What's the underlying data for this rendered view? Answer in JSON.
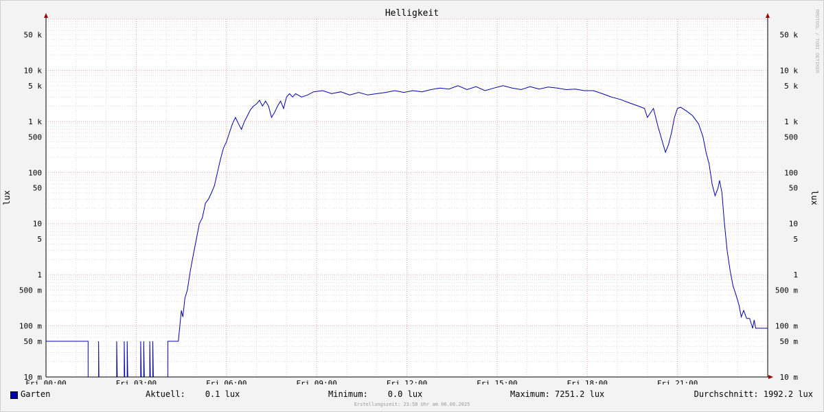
{
  "chart_data": {
    "type": "line",
    "title": "Helligkeit",
    "ylabel": "lux",
    "ylabel_right": "lux",
    "watermark": "RRDTOOL / TOBI OETIKER",
    "y_scale": "log",
    "ylim": [
      0.01,
      100000
    ],
    "y_ticks": [
      {
        "value": 0.01,
        "label": "10 m"
      },
      {
        "value": 0.05,
        "label": "50 m"
      },
      {
        "value": 0.1,
        "label": "100 m"
      },
      {
        "value": 0.5,
        "label": "500 m"
      },
      {
        "value": 1,
        "label": "1"
      },
      {
        "value": 5,
        "label": "5"
      },
      {
        "value": 10,
        "label": "10"
      },
      {
        "value": 50,
        "label": "50"
      },
      {
        "value": 100,
        "label": "100"
      },
      {
        "value": 500,
        "label": "500"
      },
      {
        "value": 1000,
        "label": "1 k"
      },
      {
        "value": 5000,
        "label": "5 k"
      },
      {
        "value": 10000,
        "label": "10 k"
      },
      {
        "value": 50000,
        "label": "50 k"
      }
    ],
    "x_range_hours": [
      0,
      24
    ],
    "x_ticks": [
      {
        "hour": 0,
        "label": "Fri 00:00"
      },
      {
        "hour": 3,
        "label": "Fri 03:00"
      },
      {
        "hour": 6,
        "label": "Fri 06:00"
      },
      {
        "hour": 9,
        "label": "Fri 09:00"
      },
      {
        "hour": 12,
        "label": "Fri 12:00"
      },
      {
        "hour": 15,
        "label": "Fri 15:00"
      },
      {
        "hour": 18,
        "label": "Fri 18:00"
      },
      {
        "hour": 21,
        "label": "Fri 21:00"
      }
    ],
    "grid": true,
    "series": [
      {
        "name": "Garten",
        "color": "#0000aa",
        "points": [
          [
            0.0,
            0.05
          ],
          [
            1.4,
            0.05
          ],
          [
            1.4,
            0.01
          ],
          [
            1.75,
            0.01
          ],
          [
            1.75,
            0.05
          ],
          [
            1.76,
            0.01
          ],
          [
            2.35,
            0.01
          ],
          [
            2.35,
            0.05
          ],
          [
            2.37,
            0.01
          ],
          [
            2.6,
            0.01
          ],
          [
            2.6,
            0.05
          ],
          [
            2.62,
            0.01
          ],
          [
            2.7,
            0.01
          ],
          [
            2.7,
            0.05
          ],
          [
            2.72,
            0.01
          ],
          [
            3.15,
            0.01
          ],
          [
            3.15,
            0.05
          ],
          [
            3.17,
            0.01
          ],
          [
            3.25,
            0.01
          ],
          [
            3.25,
            0.05
          ],
          [
            3.27,
            0.01
          ],
          [
            3.45,
            0.01
          ],
          [
            3.45,
            0.05
          ],
          [
            3.47,
            0.01
          ],
          [
            3.55,
            0.01
          ],
          [
            3.55,
            0.05
          ],
          [
            3.57,
            0.01
          ],
          [
            4.05,
            0.01
          ],
          [
            4.05,
            0.05
          ],
          [
            4.4,
            0.05
          ],
          [
            4.45,
            0.1
          ],
          [
            4.5,
            0.2
          ],
          [
            4.55,
            0.15
          ],
          [
            4.62,
            0.35
          ],
          [
            4.7,
            0.5
          ],
          [
            4.8,
            1.2
          ],
          [
            4.9,
            2.5
          ],
          [
            5.0,
            5
          ],
          [
            5.1,
            10
          ],
          [
            5.2,
            13
          ],
          [
            5.3,
            25
          ],
          [
            5.4,
            30
          ],
          [
            5.5,
            40
          ],
          [
            5.6,
            55
          ],
          [
            5.7,
            100
          ],
          [
            5.8,
            180
          ],
          [
            5.9,
            300
          ],
          [
            6.0,
            400
          ],
          [
            6.1,
            600
          ],
          [
            6.2,
            900
          ],
          [
            6.3,
            1200
          ],
          [
            6.4,
            900
          ],
          [
            6.5,
            700
          ],
          [
            6.6,
            1000
          ],
          [
            6.7,
            1300
          ],
          [
            6.8,
            1700
          ],
          [
            6.9,
            2000
          ],
          [
            7.0,
            2200
          ],
          [
            7.1,
            2600
          ],
          [
            7.2,
            2000
          ],
          [
            7.3,
            2500
          ],
          [
            7.4,
            2000
          ],
          [
            7.5,
            1200
          ],
          [
            7.6,
            1500
          ],
          [
            7.7,
            2000
          ],
          [
            7.8,
            2500
          ],
          [
            7.9,
            1800
          ],
          [
            8.0,
            3000
          ],
          [
            8.1,
            3500
          ],
          [
            8.2,
            3000
          ],
          [
            8.3,
            3500
          ],
          [
            8.5,
            3000
          ],
          [
            8.7,
            3300
          ],
          [
            8.9,
            3800
          ],
          [
            9.2,
            4000
          ],
          [
            9.5,
            3500
          ],
          [
            9.8,
            3800
          ],
          [
            10.1,
            3300
          ],
          [
            10.4,
            3700
          ],
          [
            10.7,
            3300
          ],
          [
            11.0,
            3500
          ],
          [
            11.3,
            3700
          ],
          [
            11.6,
            4000
          ],
          [
            11.9,
            3700
          ],
          [
            12.2,
            4000
          ],
          [
            12.5,
            3800
          ],
          [
            12.8,
            4200
          ],
          [
            13.1,
            4500
          ],
          [
            13.4,
            4300
          ],
          [
            13.7,
            5000
          ],
          [
            14.0,
            4200
          ],
          [
            14.3,
            4800
          ],
          [
            14.6,
            4000
          ],
          [
            14.9,
            4500
          ],
          [
            15.2,
            5000
          ],
          [
            15.5,
            4500
          ],
          [
            15.8,
            4200
          ],
          [
            16.1,
            4800
          ],
          [
            16.4,
            4300
          ],
          [
            16.7,
            4700
          ],
          [
            17.0,
            4500
          ],
          [
            17.3,
            4200
          ],
          [
            17.6,
            4300
          ],
          [
            17.9,
            4000
          ],
          [
            18.2,
            4000
          ],
          [
            18.5,
            3500
          ],
          [
            18.8,
            3000
          ],
          [
            19.1,
            2700
          ],
          [
            19.4,
            2300
          ],
          [
            19.7,
            2000
          ],
          [
            19.9,
            1800
          ],
          [
            20.0,
            1200
          ],
          [
            20.2,
            1800
          ],
          [
            20.35,
            800
          ],
          [
            20.5,
            400
          ],
          [
            20.6,
            250
          ],
          [
            20.7,
            350
          ],
          [
            20.8,
            600
          ],
          [
            20.9,
            1200
          ],
          [
            21.0,
            1800
          ],
          [
            21.1,
            1900
          ],
          [
            21.3,
            1600
          ],
          [
            21.5,
            1300
          ],
          [
            21.7,
            900
          ],
          [
            21.85,
            500
          ],
          [
            21.95,
            250
          ],
          [
            22.05,
            150
          ],
          [
            22.15,
            60
          ],
          [
            22.25,
            35
          ],
          [
            22.35,
            50
          ],
          [
            22.4,
            70
          ],
          [
            22.48,
            40
          ],
          [
            22.55,
            12
          ],
          [
            22.65,
            3
          ],
          [
            22.75,
            1.2
          ],
          [
            22.85,
            0.6
          ],
          [
            22.95,
            0.4
          ],
          [
            23.05,
            0.25
          ],
          [
            23.12,
            0.15
          ],
          [
            23.2,
            0.2
          ],
          [
            23.3,
            0.14
          ],
          [
            23.4,
            0.14
          ],
          [
            23.5,
            0.09
          ],
          [
            23.55,
            0.13
          ],
          [
            23.6,
            0.09
          ],
          [
            24.0,
            0.09
          ]
        ]
      }
    ],
    "legend": {
      "name": "Garten",
      "aktuell": "Aktuell:    0.1 lux",
      "minimum": "Minimum:    0.0 lux",
      "maximum": "Maximum: 7251.2 lux",
      "durchschnitt": "Durchschnitt: 1992.2 lux"
    },
    "footer": "Erstellungszeit: 23:58 Uhr am 06.06.2025"
  }
}
